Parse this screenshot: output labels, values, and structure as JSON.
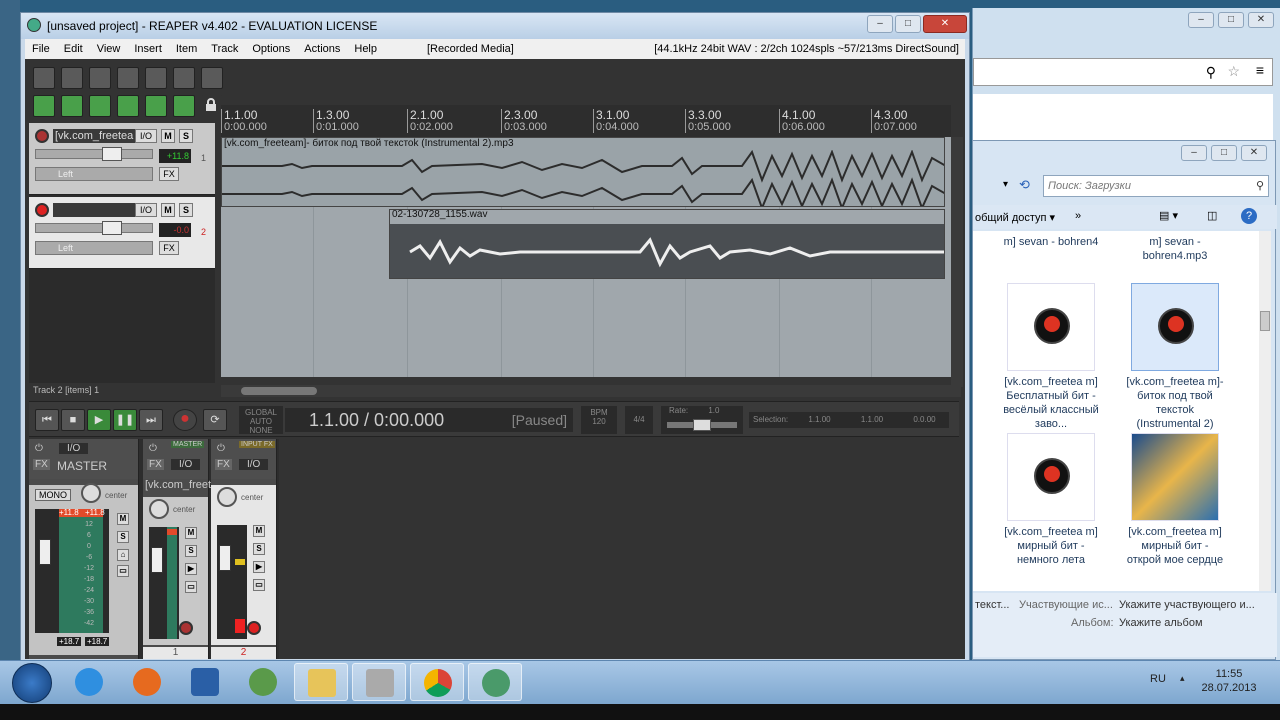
{
  "reaper": {
    "title": "[unsaved project] - REAPER v4.402 - EVALUATION LICENSE",
    "menu": [
      "File",
      "Edit",
      "View",
      "Insert",
      "Item",
      "Track",
      "Options",
      "Actions",
      "Help"
    ],
    "recorded_media": "[Recorded Media]",
    "audio_info": "[44.1kHz 24bit WAV : 2/2ch 1024spls ~57/213ms DirectSound]",
    "tracks": [
      {
        "name": "[vk.com_freetea",
        "io": "I/O",
        "m": "M",
        "s": "S",
        "volume": "+11.8",
        "pan": "Left",
        "fx": "FX",
        "num": "1"
      },
      {
        "name": "",
        "io": "I/O",
        "m": "M",
        "s": "S",
        "volume": "-0.0",
        "pan": "Left",
        "fx": "FX",
        "num": "2"
      }
    ],
    "ruler": [
      {
        "bar": "1.1.00",
        "time": "0:00.000"
      },
      {
        "bar": "1.3.00",
        "time": "0:01.000"
      },
      {
        "bar": "2.1.00",
        "time": "0:02.000"
      },
      {
        "bar": "2.3.00",
        "time": "0:03.000"
      },
      {
        "bar": "3.1.00",
        "time": "0:04.000"
      },
      {
        "bar": "3.3.00",
        "time": "0:05.000"
      },
      {
        "bar": "4.1.00",
        "time": "0:06.000"
      },
      {
        "bar": "4.3.00",
        "time": "0:07.000"
      }
    ],
    "items": [
      {
        "label": "[vk.com_freeteam]- биток под твой текстоk (Instrumental 2).mp3"
      },
      {
        "label": "02-130728_1155.wav"
      }
    ],
    "status": "Track 2 [items] 1",
    "transport": {
      "time": "1.1.00 / 0:00.000",
      "state": "[Paused]",
      "global_auto": "GLOBAL AUTO",
      "auto_mode": "NONE",
      "bpm_label": "BPM",
      "bpm": "120",
      "timesig": "4/4",
      "rate_label": "Rate:",
      "rate": "1.0",
      "selection_label": "Selection:",
      "sel_start": "1.1.00",
      "sel_end": "1.1.00",
      "sel_len": "0.0.00"
    },
    "mixer": {
      "master_label": "MASTER",
      "mono": "MONO",
      "center": "center",
      "io": "I/O",
      "fx": "FX",
      "master_peaks": [
        "+11.8",
        "+11.8"
      ],
      "master_out": [
        "+18.7",
        "+18.7"
      ],
      "master_scale": [
        "12",
        "6",
        "0",
        "-6",
        "-12",
        "-18",
        "-24",
        "-30",
        "-36",
        "-42"
      ],
      "strip1_name": "[vk.com_freet",
      "strip1_in": "MASTER",
      "strip2_in": "INPUT FX",
      "strip1_num": "1",
      "strip2_num": "2"
    }
  },
  "explorer": {
    "search_placeholder": "Поиск: Загрузки",
    "share": "общий доступ",
    "files": [
      {
        "name": "m] sevan - bohren4"
      },
      {
        "name": "m] sevan - bohren4.mp3"
      },
      {
        "name": "[vk.com_freetea m] Бесплатный бит - весёлый классный заво..."
      },
      {
        "name": "[vk.com_freetea m]- биток под твой текстоk (Instrumental 2)"
      },
      {
        "name": "[vk.com_freetea m] мирный бит - немного лета"
      },
      {
        "name": "[vk.com_freetea m] мирный бит - открой мое сердце"
      }
    ],
    "details": {
      "col1": "текст...",
      "col2": "Участвующие ис...",
      "col3": "Укажите участвующего и...",
      "album_label": "Альбом:",
      "album_value": "Укажите альбом"
    }
  },
  "taskbar": {
    "lang": "RU",
    "time": "11:55",
    "date": "28.07.2013"
  }
}
